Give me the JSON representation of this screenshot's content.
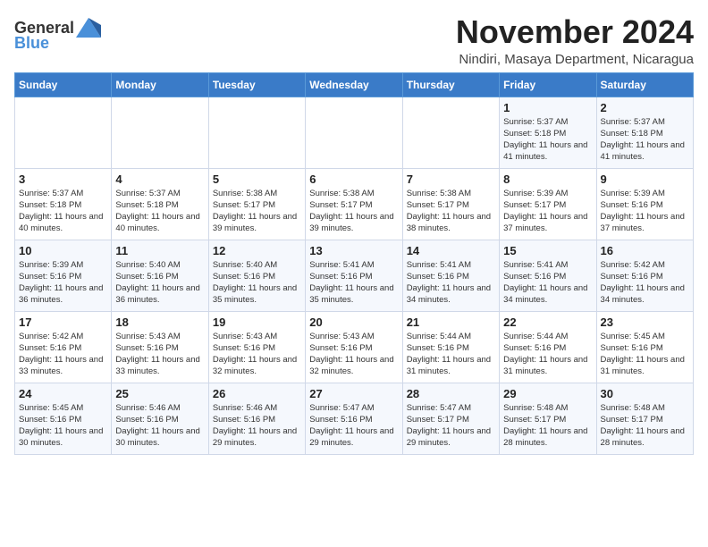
{
  "header": {
    "logo_general": "General",
    "logo_blue": "Blue",
    "month_title": "November 2024",
    "location": "Nindiri, Masaya Department, Nicaragua"
  },
  "weekdays": [
    "Sunday",
    "Monday",
    "Tuesday",
    "Wednesday",
    "Thursday",
    "Friday",
    "Saturday"
  ],
  "weeks": [
    [
      {
        "day": "",
        "info": ""
      },
      {
        "day": "",
        "info": ""
      },
      {
        "day": "",
        "info": ""
      },
      {
        "day": "",
        "info": ""
      },
      {
        "day": "",
        "info": ""
      },
      {
        "day": "1",
        "info": "Sunrise: 5:37 AM\nSunset: 5:18 PM\nDaylight: 11 hours and 41 minutes."
      },
      {
        "day": "2",
        "info": "Sunrise: 5:37 AM\nSunset: 5:18 PM\nDaylight: 11 hours and 41 minutes."
      }
    ],
    [
      {
        "day": "3",
        "info": "Sunrise: 5:37 AM\nSunset: 5:18 PM\nDaylight: 11 hours and 40 minutes."
      },
      {
        "day": "4",
        "info": "Sunrise: 5:37 AM\nSunset: 5:18 PM\nDaylight: 11 hours and 40 minutes."
      },
      {
        "day": "5",
        "info": "Sunrise: 5:38 AM\nSunset: 5:17 PM\nDaylight: 11 hours and 39 minutes."
      },
      {
        "day": "6",
        "info": "Sunrise: 5:38 AM\nSunset: 5:17 PM\nDaylight: 11 hours and 39 minutes."
      },
      {
        "day": "7",
        "info": "Sunrise: 5:38 AM\nSunset: 5:17 PM\nDaylight: 11 hours and 38 minutes."
      },
      {
        "day": "8",
        "info": "Sunrise: 5:39 AM\nSunset: 5:17 PM\nDaylight: 11 hours and 37 minutes."
      },
      {
        "day": "9",
        "info": "Sunrise: 5:39 AM\nSunset: 5:16 PM\nDaylight: 11 hours and 37 minutes."
      }
    ],
    [
      {
        "day": "10",
        "info": "Sunrise: 5:39 AM\nSunset: 5:16 PM\nDaylight: 11 hours and 36 minutes."
      },
      {
        "day": "11",
        "info": "Sunrise: 5:40 AM\nSunset: 5:16 PM\nDaylight: 11 hours and 36 minutes."
      },
      {
        "day": "12",
        "info": "Sunrise: 5:40 AM\nSunset: 5:16 PM\nDaylight: 11 hours and 35 minutes."
      },
      {
        "day": "13",
        "info": "Sunrise: 5:41 AM\nSunset: 5:16 PM\nDaylight: 11 hours and 35 minutes."
      },
      {
        "day": "14",
        "info": "Sunrise: 5:41 AM\nSunset: 5:16 PM\nDaylight: 11 hours and 34 minutes."
      },
      {
        "day": "15",
        "info": "Sunrise: 5:41 AM\nSunset: 5:16 PM\nDaylight: 11 hours and 34 minutes."
      },
      {
        "day": "16",
        "info": "Sunrise: 5:42 AM\nSunset: 5:16 PM\nDaylight: 11 hours and 34 minutes."
      }
    ],
    [
      {
        "day": "17",
        "info": "Sunrise: 5:42 AM\nSunset: 5:16 PM\nDaylight: 11 hours and 33 minutes."
      },
      {
        "day": "18",
        "info": "Sunrise: 5:43 AM\nSunset: 5:16 PM\nDaylight: 11 hours and 33 minutes."
      },
      {
        "day": "19",
        "info": "Sunrise: 5:43 AM\nSunset: 5:16 PM\nDaylight: 11 hours and 32 minutes."
      },
      {
        "day": "20",
        "info": "Sunrise: 5:43 AM\nSunset: 5:16 PM\nDaylight: 11 hours and 32 minutes."
      },
      {
        "day": "21",
        "info": "Sunrise: 5:44 AM\nSunset: 5:16 PM\nDaylight: 11 hours and 31 minutes."
      },
      {
        "day": "22",
        "info": "Sunrise: 5:44 AM\nSunset: 5:16 PM\nDaylight: 11 hours and 31 minutes."
      },
      {
        "day": "23",
        "info": "Sunrise: 5:45 AM\nSunset: 5:16 PM\nDaylight: 11 hours and 31 minutes."
      }
    ],
    [
      {
        "day": "24",
        "info": "Sunrise: 5:45 AM\nSunset: 5:16 PM\nDaylight: 11 hours and 30 minutes."
      },
      {
        "day": "25",
        "info": "Sunrise: 5:46 AM\nSunset: 5:16 PM\nDaylight: 11 hours and 30 minutes."
      },
      {
        "day": "26",
        "info": "Sunrise: 5:46 AM\nSunset: 5:16 PM\nDaylight: 11 hours and 29 minutes."
      },
      {
        "day": "27",
        "info": "Sunrise: 5:47 AM\nSunset: 5:16 PM\nDaylight: 11 hours and 29 minutes."
      },
      {
        "day": "28",
        "info": "Sunrise: 5:47 AM\nSunset: 5:17 PM\nDaylight: 11 hours and 29 minutes."
      },
      {
        "day": "29",
        "info": "Sunrise: 5:48 AM\nSunset: 5:17 PM\nDaylight: 11 hours and 28 minutes."
      },
      {
        "day": "30",
        "info": "Sunrise: 5:48 AM\nSunset: 5:17 PM\nDaylight: 11 hours and 28 minutes."
      }
    ]
  ]
}
